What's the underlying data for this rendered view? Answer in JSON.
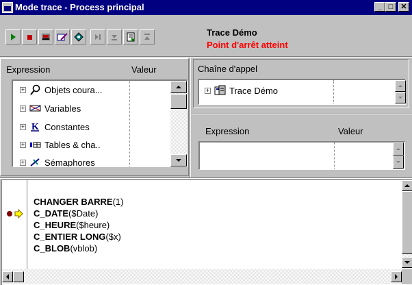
{
  "window": {
    "title": "Mode trace - Process principal"
  },
  "caption_buttons": {
    "minimize": "_",
    "maximize": "□",
    "close": "✕"
  },
  "toolbar": {
    "buttons": [
      {
        "name": "run-icon"
      },
      {
        "name": "stop-icon"
      },
      {
        "name": "step-into-icon"
      },
      {
        "name": "edit-icon"
      },
      {
        "name": "abort-icon"
      },
      {
        "name": "step-over-icon"
      },
      {
        "name": "step-down-icon"
      },
      {
        "name": "debug-icon"
      },
      {
        "name": "step-up-icon"
      }
    ]
  },
  "trace": {
    "name": "Trace Démo",
    "status": "Point d'arrêt atteint",
    "status_color": "#ff0000"
  },
  "expression_panel": {
    "header_expression": "Expression",
    "header_value": "Valeur",
    "items": [
      {
        "label": "Objets coura...",
        "icon": "magnifier-icon"
      },
      {
        "label": "Variables",
        "icon": "variable-icon"
      },
      {
        "label": "Constantes",
        "icon": "constant-icon"
      },
      {
        "label": "Tables & cha..",
        "icon": "table-icon"
      },
      {
        "label": "Sémaphores",
        "icon": "semaphore-icon"
      }
    ]
  },
  "call_chain": {
    "label": "Chaîne d'appel",
    "items": [
      {
        "label": "Trace Démo",
        "icon": "method-icon"
      }
    ]
  },
  "custom_expression_panel": {
    "header_expression": "Expression",
    "header_value": "Valeur"
  },
  "code": {
    "lines": [
      {
        "keyword": "CHANGER BARRE",
        "args": "(1)"
      },
      {
        "keyword": "C_DATE",
        "args": "($Date)"
      },
      {
        "keyword": "C_HEURE",
        "args": "($heure)"
      },
      {
        "keyword": "C_ENTIER LONG",
        "args": "($x)"
      },
      {
        "keyword": "C_BLOB",
        "args": "(vblob)"
      }
    ],
    "current_line_index": 1,
    "breakpoint_color": "#800000",
    "pointer_color": "#ffff00"
  }
}
